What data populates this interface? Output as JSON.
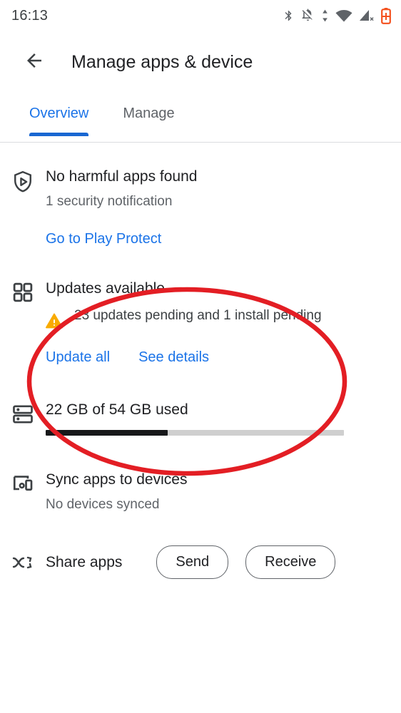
{
  "status_bar": {
    "time": "16:13",
    "icons": [
      "bluetooth-icon",
      "notifications-off-icon",
      "mobile-data-icon",
      "wifi-icon",
      "cell-signal-off-icon",
      "battery-charging-icon"
    ],
    "battery_color": "#F4511E"
  },
  "app_bar": {
    "back_icon": "arrow-back-icon",
    "title": "Manage apps & device"
  },
  "tabs": {
    "items": [
      {
        "label": "Overview",
        "active": true
      },
      {
        "label": "Manage",
        "active": false
      }
    ],
    "active_color": "#1a73e8",
    "indicator_color": "#1967d2"
  },
  "rows": {
    "play_protect": {
      "icon": "play-protect-shield-icon",
      "title": "No harmful apps found",
      "subtitle": "1 security notification",
      "link": "Go to Play Protect"
    },
    "updates": {
      "icon": "apps-grid-icon",
      "title": "Updates available",
      "warning_icon": "warning-triangle-icon",
      "warning_color": "#F9AB00",
      "subtitle": "23 updates pending and 1 install pending",
      "link_primary": "Update all",
      "link_secondary": "See details"
    },
    "storage": {
      "icon": "storage-icon",
      "title": "22 GB of 54 GB used",
      "used_gb": 22,
      "total_gb": 54,
      "progress_percent": 41,
      "fill_color": "#17181a",
      "track_color": "#cfcfcf"
    },
    "sync": {
      "icon": "devices-icon",
      "title": "Sync apps to devices",
      "subtitle": "No devices synced"
    },
    "share": {
      "icon": "nearby-share-icon",
      "title": "Share apps",
      "send_label": "Send",
      "receive_label": "Receive"
    }
  },
  "annotation": {
    "shape": "ellipse",
    "color": "#E31E24",
    "stroke_width": 6,
    "target": "updates-available-row"
  }
}
